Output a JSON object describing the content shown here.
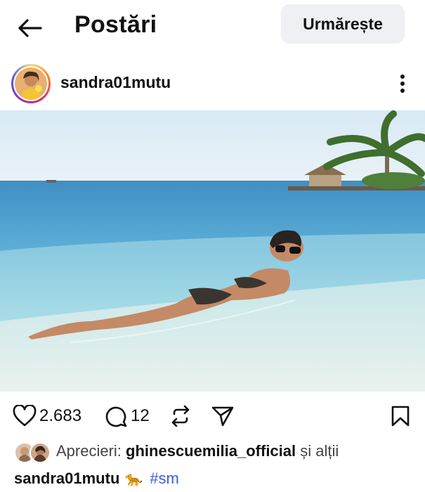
{
  "header": {
    "title": "Postări",
    "follow_label": "Urmărește",
    "back_icon": "arrow-left-icon"
  },
  "post": {
    "username": "sandra01mutu",
    "more_icon": "more-vertical-icon",
    "image_alt": "Woman lying in shallow water at a tropical beach"
  },
  "actions": {
    "likes_count": "2.683",
    "comments_count": "12",
    "icons": [
      "heart-icon",
      "comment-icon",
      "repost-icon",
      "share-icon",
      "bookmark-icon"
    ]
  },
  "likes": {
    "prefix": "Aprecieri:",
    "liker": "ghinescuemilia_official",
    "suffix": "și alții"
  },
  "caption": {
    "username": "sandra01mutu",
    "emoji": "🐆",
    "hashtag": "#sm"
  },
  "colors": {
    "follow_bg": "#eef0f3",
    "hashtag": "#3b5bdb"
  }
}
